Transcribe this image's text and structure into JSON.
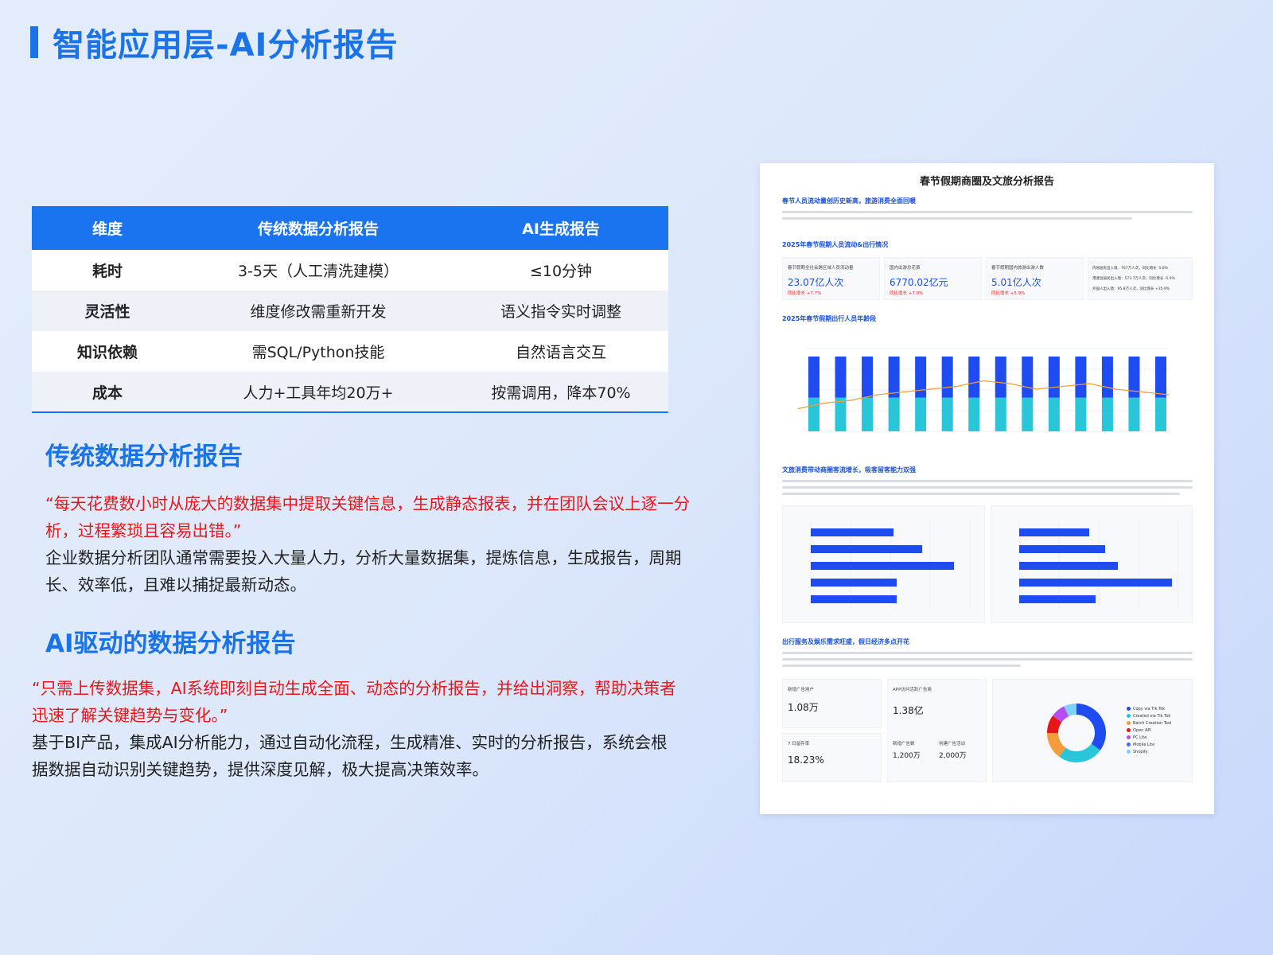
{
  "header": {
    "title": "智能应用层-AI分析报告"
  },
  "comparison": {
    "headers": [
      "维度",
      "传统数据分析报告",
      "AI生成报告"
    ],
    "rows": [
      [
        "耗时",
        "3-5天（人工清洗建模）",
        "≤10分钟"
      ],
      [
        "灵活性",
        "维度修改需重新开发",
        "语义指令实时调整"
      ],
      [
        "知识依赖",
        "需SQL/Python技能",
        "自然语言交互"
      ],
      [
        "成本",
        "人力+工具年均20万+",
        "按需调用，降本70%"
      ]
    ]
  },
  "traditional": {
    "heading": "传统数据分析报告",
    "quote": "“每天花费数小时从庞大的数据集中提取关键信息，生成静态报表，并在团队会议上逐一分析，过程繁琐且容易出错。”",
    "body": "企业数据分析团队通常需要投入大量人力，分析大量数据集，提炼信息，生成报告，周期长、效率低，且难以捕捉最新动态。"
  },
  "ai": {
    "heading": "AI驱动的数据分析报告",
    "quote": "“只需上传数据集，AI系统即刻自动生成全面、动态的分析报告，并给出洞察，帮助决策者迅速了解关键趋势与变化。”",
    "body": "基于BI产品，集成AI分析能力，通过自动化流程，生成精准、实时的分析报告，系统会根据数据自动识别关键趋势，提供深度见解，极大提高决策效率。"
  },
  "report": {
    "title": "春节假期商圈及文旅分析报告",
    "section1": "春节人员流动量创历史新高，旅游消费全面回暖",
    "section2": "2025年春节假期人员流动&出行情况",
    "section3": "2025年春节假期出行人员年龄段",
    "section4": "文旅消费带动商圈客流增长，吸客留客能力双强",
    "section5": "出行服务及娱乐需求旺盛，假日经济多点开花",
    "kpis": [
      {
        "label": "春节假期全社会跨区域人员流动量",
        "value": "23.07亿人次",
        "change": "同比增长 +7.7%"
      },
      {
        "label": "国内出游总花费",
        "value": "6770.02亿元",
        "change": "同比增长 +7.0%"
      },
      {
        "label": "春节假期国内旅游出游人数",
        "value": "5.01亿人次",
        "change": "同比增长 +5.9%"
      }
    ],
    "kpi_bullets": [
      "内地居民出入境：767万人次，同比增长 -5.8%",
      "港澳台居民出入境：573.7万人次，同比增长 -5.9%",
      "外国人出入境：95.8万人次，同比增长 +35.9%"
    ],
    "donut_legend": [
      "Copy via Tik Tok",
      "Created via Tik Tok",
      "Batch Creation Tool",
      "Open API",
      "PC Lite",
      "Mobile Lite",
      "Shopify"
    ],
    "bottom_kpis": [
      {
        "label": "新增广告用户",
        "value": "1.08万"
      },
      {
        "label": "7 日留存率",
        "value": "18.23%"
      },
      {
        "label": "APP访问活跃广告商",
        "value": "1.38亿"
      },
      {
        "label": "新增广告数",
        "value": "1,200万"
      },
      {
        "label": "创建广告活动",
        "value": "2,000万"
      }
    ]
  },
  "colors": {
    "accent": "#1a73e8",
    "table_header": "#1a74f0",
    "quote": "#e8161a"
  },
  "chart_data": [
    {
      "type": "bar",
      "title": "2025年春节假期出行人员年龄段",
      "series": [
        {
          "name": "stack_top",
          "values": [
            0.55,
            0.55,
            0.55,
            0.55,
            0.55,
            0.55,
            0.55,
            0.55,
            0.55,
            0.55,
            0.55,
            0.55,
            0.55,
            0.55
          ]
        },
        {
          "name": "stack_bottom",
          "values": [
            0.45,
            0.45,
            0.45,
            0.45,
            0.45,
            0.45,
            0.45,
            0.45,
            0.45,
            0.45,
            0.45,
            0.45,
            0.45,
            0.45
          ]
        },
        {
          "name": "line",
          "values": [
            0.05,
            0.15,
            0.2,
            0.3,
            0.35,
            0.4,
            0.45,
            0.55,
            0.5,
            0.4,
            0.45,
            0.5,
            0.4,
            0.35,
            0.3
          ]
        }
      ],
      "colors": [
        "#1f4cf0",
        "#29c6d9",
        "#f59c3c"
      ]
    },
    {
      "type": "bar",
      "orientation": "horizontal",
      "values": [
        0.52,
        0.7,
        0.9,
        0.54,
        0.54
      ],
      "color": "#1f4cf0"
    },
    {
      "type": "bar",
      "orientation": "horizontal",
      "values": [
        0.44,
        0.54,
        0.62,
        0.96,
        0.48
      ],
      "color": "#1f4cf0"
    },
    {
      "type": "pie",
      "values": [
        35,
        25,
        15,
        10,
        8,
        7
      ],
      "colors": [
        "#1f4cf0",
        "#29c6d9",
        "#f59c3c",
        "#e8161a",
        "#b54df0",
        "#7fd0ff"
      ]
    }
  ]
}
